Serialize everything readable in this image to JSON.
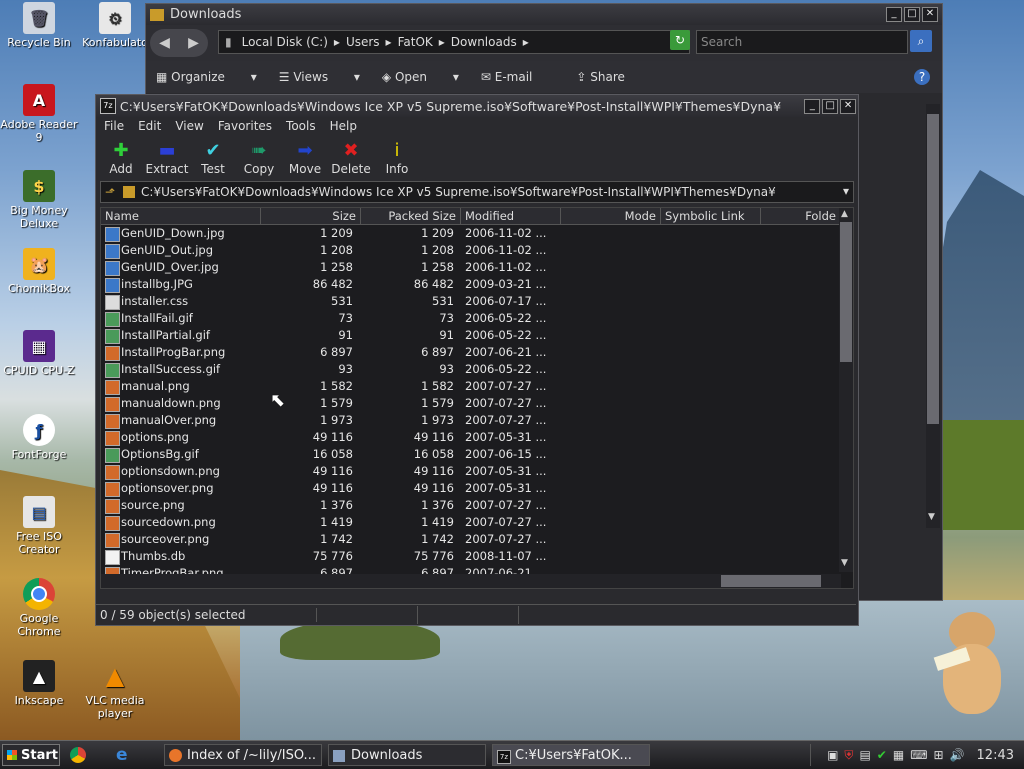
{
  "desktop": {
    "icons": [
      {
        "label": "Recycle Bin"
      },
      {
        "label": "Konfabulato"
      },
      {
        "label": "Adobe Reader 9"
      },
      {
        "label": "Big Money Deluxe"
      },
      {
        "label": "ChomikBox"
      },
      {
        "label": "CPUID CPU-Z"
      },
      {
        "label": "FontForge"
      },
      {
        "label": "Free ISO Creator"
      },
      {
        "label": "Google Chrome"
      },
      {
        "label": "Inkscape"
      },
      {
        "label": "VLC media player"
      }
    ]
  },
  "explorer": {
    "title": "Downloads",
    "breadcrumb": [
      "Local Disk (C:)",
      "Users",
      "FatOK",
      "Downloads"
    ],
    "search_placeholder": "Search",
    "commands": [
      "Organize",
      "Views",
      "Open",
      "E-mail",
      "Share"
    ]
  },
  "sevenzip": {
    "title": "C:¥Users¥FatOK¥Downloads¥Windows Ice XP v5 Supreme.iso¥Software¥Post-Install¥WPI¥Themes¥Dyna¥",
    "menu": [
      "File",
      "Edit",
      "View",
      "Favorites",
      "Tools",
      "Help"
    ],
    "toolbar": [
      {
        "label": "Add",
        "glyph": "✚",
        "color": "#2fcf3a"
      },
      {
        "label": "Extract",
        "glyph": "▬",
        "color": "#2b3fd6"
      },
      {
        "label": "Test",
        "glyph": "✔",
        "color": "#3fd0e0"
      },
      {
        "label": "Copy",
        "glyph": "➠",
        "color": "#1f9a6a"
      },
      {
        "label": "Move",
        "glyph": "➡",
        "color": "#2244cc"
      },
      {
        "label": "Delete",
        "glyph": "✖",
        "color": "#e02020"
      },
      {
        "label": "Info",
        "glyph": "i",
        "color": "#e8d400"
      }
    ],
    "address": "C:¥Users¥FatOK¥Downloads¥Windows Ice XP v5 Supreme.iso¥Software¥Post-Install¥WPI¥Themes¥Dyna¥",
    "columns": [
      "Name",
      "Size",
      "Packed Size",
      "Modified",
      "Mode",
      "Symbolic Link",
      "Folde"
    ],
    "files": [
      {
        "name": "GenUID_Down.jpg",
        "size": "1 209",
        "packed": "1 209",
        "modified": "2006-11-02 ...",
        "icon": "#3b78c8"
      },
      {
        "name": "GenUID_Out.jpg",
        "size": "1 208",
        "packed": "1 208",
        "modified": "2006-11-02 ...",
        "icon": "#3b78c8"
      },
      {
        "name": "GenUID_Over.jpg",
        "size": "1 258",
        "packed": "1 258",
        "modified": "2006-11-02 ...",
        "icon": "#3b78c8"
      },
      {
        "name": "installbg.JPG",
        "size": "86 482",
        "packed": "86 482",
        "modified": "2009-03-21 ...",
        "icon": "#3b78c8"
      },
      {
        "name": "installer.css",
        "size": "531",
        "packed": "531",
        "modified": "2006-07-17 ...",
        "icon": "#dcdcdc"
      },
      {
        "name": "InstallFail.gif",
        "size": "73",
        "packed": "73",
        "modified": "2006-05-22 ...",
        "icon": "#4a9a5a"
      },
      {
        "name": "InstallPartial.gif",
        "size": "91",
        "packed": "91",
        "modified": "2006-05-22 ...",
        "icon": "#4a9a5a"
      },
      {
        "name": "InstallProgBar.png",
        "size": "6 897",
        "packed": "6 897",
        "modified": "2007-06-21 ...",
        "icon": "#d26a2a"
      },
      {
        "name": "InstallSuccess.gif",
        "size": "93",
        "packed": "93",
        "modified": "2006-05-22 ...",
        "icon": "#4a9a5a"
      },
      {
        "name": "manual.png",
        "size": "1 582",
        "packed": "1 582",
        "modified": "2007-07-27 ...",
        "icon": "#d26a2a"
      },
      {
        "name": "manualdown.png",
        "size": "1 579",
        "packed": "1 579",
        "modified": "2007-07-27 ...",
        "icon": "#d26a2a"
      },
      {
        "name": "manualOver.png",
        "size": "1 973",
        "packed": "1 973",
        "modified": "2007-07-27 ...",
        "icon": "#d26a2a"
      },
      {
        "name": "options.png",
        "size": "49 116",
        "packed": "49 116",
        "modified": "2007-05-31 ...",
        "icon": "#d26a2a"
      },
      {
        "name": "OptionsBg.gif",
        "size": "16 058",
        "packed": "16 058",
        "modified": "2007-06-15 ...",
        "icon": "#4a9a5a"
      },
      {
        "name": "optionsdown.png",
        "size": "49 116",
        "packed": "49 116",
        "modified": "2007-05-31 ...",
        "icon": "#d26a2a"
      },
      {
        "name": "optionsover.png",
        "size": "49 116",
        "packed": "49 116",
        "modified": "2007-05-31 ...",
        "icon": "#d26a2a"
      },
      {
        "name": "source.png",
        "size": "1 376",
        "packed": "1 376",
        "modified": "2007-07-27 ...",
        "icon": "#d26a2a"
      },
      {
        "name": "sourcedown.png",
        "size": "1 419",
        "packed": "1 419",
        "modified": "2007-07-27 ...",
        "icon": "#d26a2a"
      },
      {
        "name": "sourceover.png",
        "size": "1 742",
        "packed": "1 742",
        "modified": "2007-07-27 ...",
        "icon": "#d26a2a"
      },
      {
        "name": "Thumbs.db",
        "size": "75 776",
        "packed": "75 776",
        "modified": "2008-11-07 ...",
        "icon": "#f2f2f2"
      },
      {
        "name": "TimerProgBar.png",
        "size": "6 897",
        "packed": "6 897",
        "modified": "2007-06-21 ...",
        "icon": "#d26a2a"
      }
    ],
    "status": "0 / 59 object(s) selected"
  },
  "taskbar": {
    "start": "Start",
    "items": [
      "Index of /~lily/ISO...",
      "Downloads",
      "C:¥Users¥FatOK..."
    ],
    "clock": "12:43"
  }
}
